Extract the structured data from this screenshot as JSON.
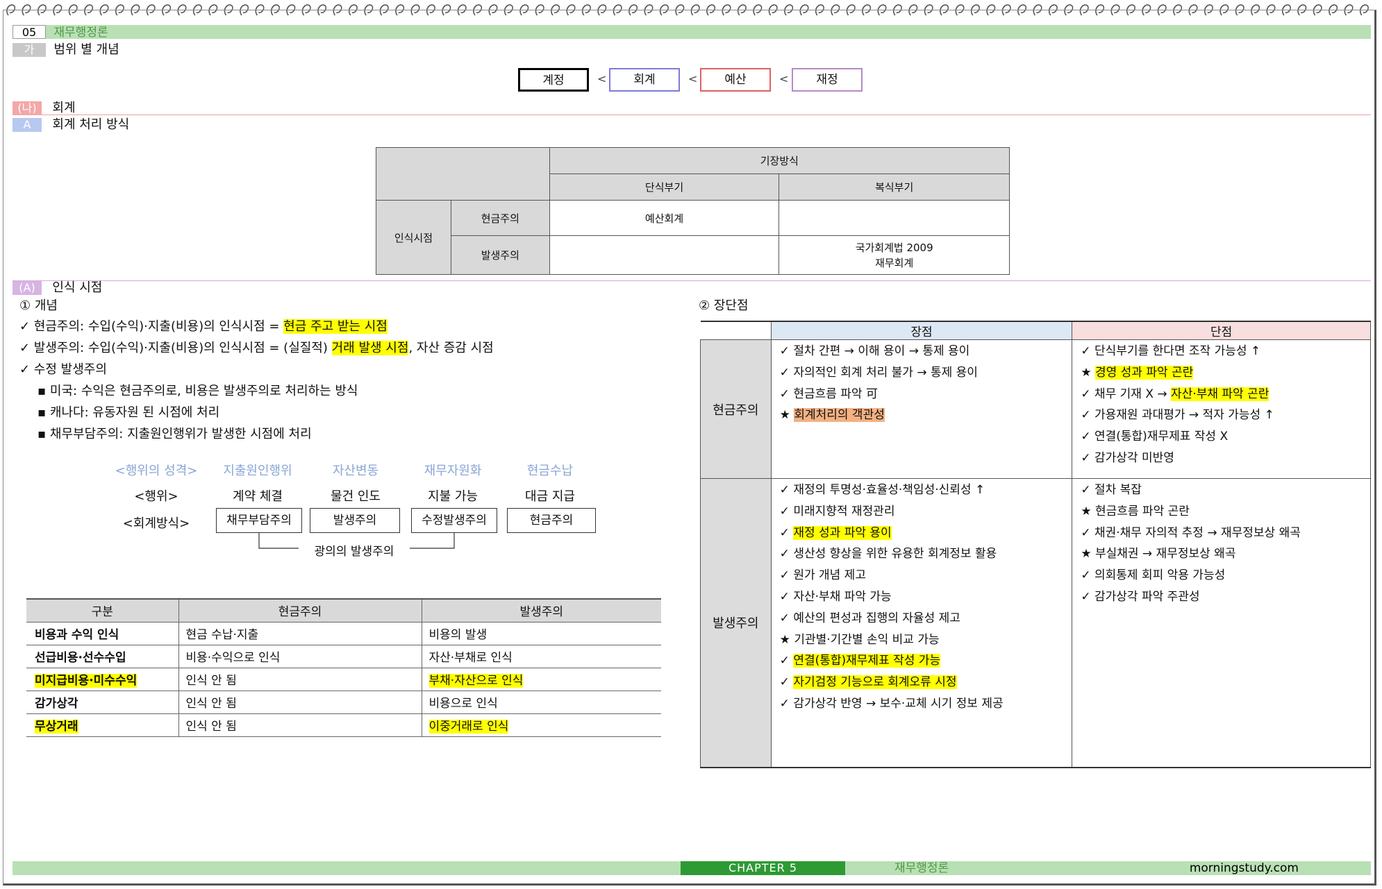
{
  "header": {
    "chapter_num": "05",
    "chapter_title": "재무행정론"
  },
  "sec_ga": {
    "tag": "가",
    "title": "범위 별 개념"
  },
  "concepts": {
    "items": [
      {
        "label": "계정",
        "color": "#000000"
      },
      {
        "label": "회계",
        "color": "#7b7bd9"
      },
      {
        "label": "예산",
        "color": "#e06060"
      },
      {
        "label": "재정",
        "color": "#b58ac7"
      }
    ],
    "separator": "<"
  },
  "sec_na": {
    "tag": "(나)",
    "title": "회계"
  },
  "sec_a": {
    "tag": "A",
    "title": "회계 처리 방식"
  },
  "table1": {
    "header_top": "기장방식",
    "col1": "단식부기",
    "col2": "복식부기",
    "row_group": "인식시점",
    "row1": "현금주의",
    "row2": "발생주의",
    "r1c1": "예산회계",
    "r1c2": "",
    "r2c1": "",
    "r2c2_line1": "국가회계법 2009",
    "r2c2_line2": "재무회계"
  },
  "sec_A": {
    "tag": "(A)",
    "title": "인식 시점"
  },
  "concept": {
    "heading": "① 개념",
    "l1_pre": "✓ 현금주의: 수입(수익)·지출(비용)의 인식시점 = ",
    "l1_hl": "현금 주고 받는 시점",
    "l2_pre": "✓ 발생주의: 수입(수익)·지출(비용)의 인식시점 = (실질적) ",
    "l2_hl": "거래 발생 시점",
    "l2_post": ", 자산 증감 시점",
    "l3": "✓ 수정 발생주의",
    "b1": "▪ 미국: 수익은 현금주의로, 비용은 발생주의로 처리하는 방식",
    "b2": "▪ 캐나다: 유동자원 된 시점에 처리",
    "b3": "▪ 채무부담주의: 지출원인행위가 발생한 시점에 처리"
  },
  "flow": {
    "row0_label": "<행위의 성격>",
    "row0": [
      "지출원인행위",
      "자산변동",
      "재무자원화",
      "현금수납"
    ],
    "row1_label": "<행위>",
    "row1": [
      "계약 체결",
      "물건 인도",
      "지불 가능",
      "대금 지급"
    ],
    "row2_label": "<회계방식>",
    "row2": [
      "채무부담주의",
      "발생주의",
      "수정발생주의",
      "현금주의"
    ],
    "bracket_label": "광의의 발생주의"
  },
  "table2": {
    "headers": [
      "구분",
      "현금주의",
      "발생주의"
    ],
    "rows": [
      {
        "c0": "비용과 수익 인식",
        "c1": "현금 수납·지출",
        "c2": "비용의 발생",
        "hl": false
      },
      {
        "c0": "선급비용·선수수입",
        "c1": "비용·수익으로 인식",
        "c2": "자산·부채로 인식",
        "hl": false
      },
      {
        "c0": "미지급비용·미수수익",
        "c1": "인식 안 됨",
        "c2": "부채·자산으로 인식",
        "hl": true
      },
      {
        "c0": "감가상각",
        "c1": "인식 안 됨",
        "c2": "비용으로 인식",
        "hl": false
      },
      {
        "c0": "무상거래",
        "c1": "인식 안 됨",
        "c2": "이중거래로 인식",
        "hl": true
      }
    ]
  },
  "pros_cons": {
    "heading": "② 장단점",
    "col_pro": "장점",
    "col_con": "단점",
    "row_cash": "현금주의",
    "row_accrual": "발생주의",
    "cash_pro": [
      {
        "t": "✓ 절차 간편 → 이해 용이 → 통제 용이",
        "h": ""
      },
      {
        "t": "✓ 자의적인 회계 처리 불가 → 통제 용이",
        "h": ""
      },
      {
        "t": "✓ 현금흐름 파악 可",
        "h": ""
      },
      {
        "p": "★ ",
        "t": "회계처리의 객관성",
        "h": "o"
      }
    ],
    "cash_con": [
      {
        "t": "✓ 단식부기를 한다면 조작 가능성 ↑",
        "h": ""
      },
      {
        "p": "★ ",
        "t": "경영 성과 파악 곤란",
        "h": "y"
      },
      {
        "p": "✓ 채무 기재 X → ",
        "t": "자산·부채 파악 곤란",
        "h": "y"
      },
      {
        "t": "✓ 가용재원 과대평가 → 적자 가능성 ↑",
        "h": ""
      },
      {
        "t": "✓ 연결(통합)재무제표 작성 X",
        "h": ""
      },
      {
        "t": "✓ 감가상각 미반영",
        "h": ""
      }
    ],
    "accrual_pro": [
      {
        "t": "✓ 재정의 투명성·효율성·책임성·신뢰성 ↑",
        "h": ""
      },
      {
        "t": "✓ 미래지향적 재정관리",
        "h": ""
      },
      {
        "p": "✓ ",
        "t": "재정 성과 파악 용이",
        "h": "y"
      },
      {
        "t": "✓ 생산성 향상을 위한 유용한 회계정보 활용",
        "h": ""
      },
      {
        "t": "✓ 원가 개념 제고",
        "h": ""
      },
      {
        "t": "✓ 자산·부채 파악 가능",
        "h": ""
      },
      {
        "t": "✓ 예산의 편성과 집행의 자율성 제고",
        "h": ""
      },
      {
        "t": "★ 기관별·기간별 손익 비교 가능",
        "h": ""
      },
      {
        "p": "✓ ",
        "t": "연결(통합)재무제표 작성 가능",
        "h": "y"
      },
      {
        "p": "✓ ",
        "t": "자기검정 기능으로 회계오류 시정",
        "h": "y"
      },
      {
        "t": "✓ 감가상각 반영 → 보수·교체 시기 정보 제공",
        "h": ""
      }
    ],
    "accrual_con": [
      {
        "t": "✓ 절차 복잡",
        "h": ""
      },
      {
        "t": "★ 현금흐름 파악 곤란",
        "h": ""
      },
      {
        "t": "✓ 채권·채무 자의적 추정 → 재무정보상 왜곡",
        "h": ""
      },
      {
        "t": "★ 부실채권 → 재무정보상 왜곡",
        "h": ""
      },
      {
        "t": "✓ 의회통제 회피 악용 가능성",
        "h": ""
      },
      {
        "t": "✓ 감가상각 파악 주관성",
        "h": ""
      }
    ]
  },
  "footer": {
    "chapter": "CHAPTER 5",
    "title": "재무행정론",
    "site": "morningstudy.com"
  }
}
